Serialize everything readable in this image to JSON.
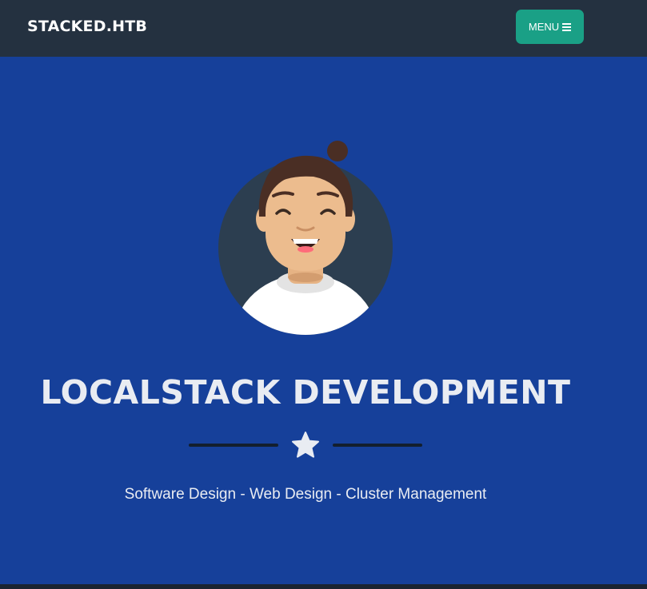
{
  "navbar": {
    "brand": "STACKED.HTB",
    "menu_label": "MENU",
    "menu_icon": "bars-icon"
  },
  "masthead": {
    "avatar": "avatar-illustration",
    "title": "LOCALSTACK DEVELOPMENT",
    "divider_icon": "star-icon",
    "subtitle": "Software Design - Web Design - Cluster Management"
  },
  "colors": {
    "navbar_bg": "#243140",
    "menu_button": "#1aa086",
    "masthead_bg": "#16409a",
    "text": "#e9ecf2",
    "divider": "#131f2e"
  }
}
